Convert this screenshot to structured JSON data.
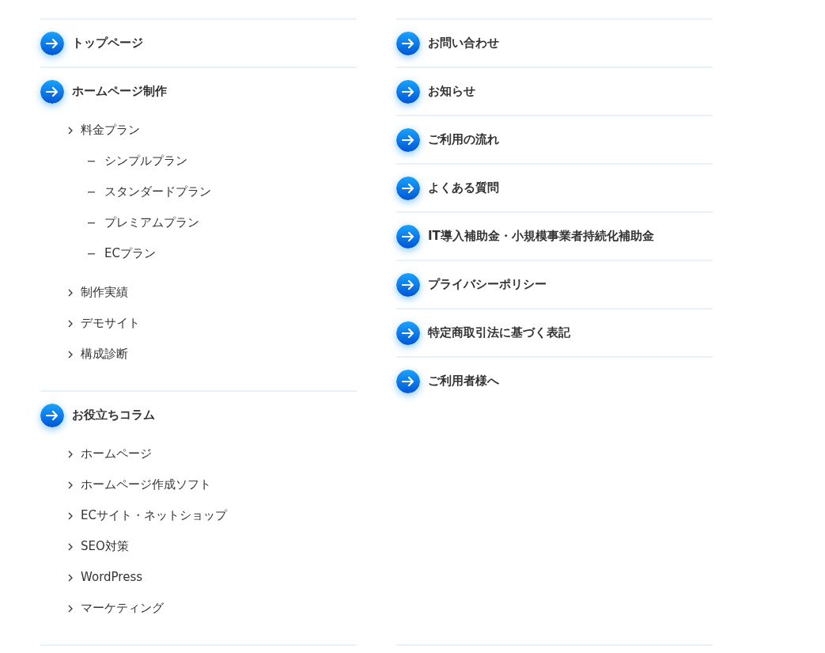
{
  "columns": [
    {
      "sections": [
        {
          "title": "トップページ"
        },
        {
          "title": "ホームページ制作",
          "children": [
            {
              "label": "料金プラン",
              "children": [
                {
                  "label": "シンプルプラン"
                },
                {
                  "label": "スタンダードプラン"
                },
                {
                  "label": "プレミアムプラン"
                },
                {
                  "label": "ECプラン"
                }
              ]
            },
            {
              "label": "制作実績"
            },
            {
              "label": "デモサイト"
            },
            {
              "label": "構成診断"
            }
          ]
        },
        {
          "title": "お役立ちコラム",
          "children": [
            {
              "label": "ホームページ"
            },
            {
              "label": "ホームページ作成ソフト"
            },
            {
              "label": "ECサイト・ネットショップ"
            },
            {
              "label": "SEO対策"
            },
            {
              "label": "WordPress"
            },
            {
              "label": "マーケティング"
            }
          ]
        }
      ]
    },
    {
      "sections": [
        {
          "title": "お問い合わせ"
        },
        {
          "title": "お知らせ"
        },
        {
          "title": "ご利用の流れ"
        },
        {
          "title": "よくある質問"
        },
        {
          "title": "IT導入補助金・小規模事業者持続化補助金"
        },
        {
          "title": "プライバシーポリシー"
        },
        {
          "title": "特定商取引法に基づく表記"
        },
        {
          "title": "ご利用者様へ"
        }
      ]
    }
  ]
}
